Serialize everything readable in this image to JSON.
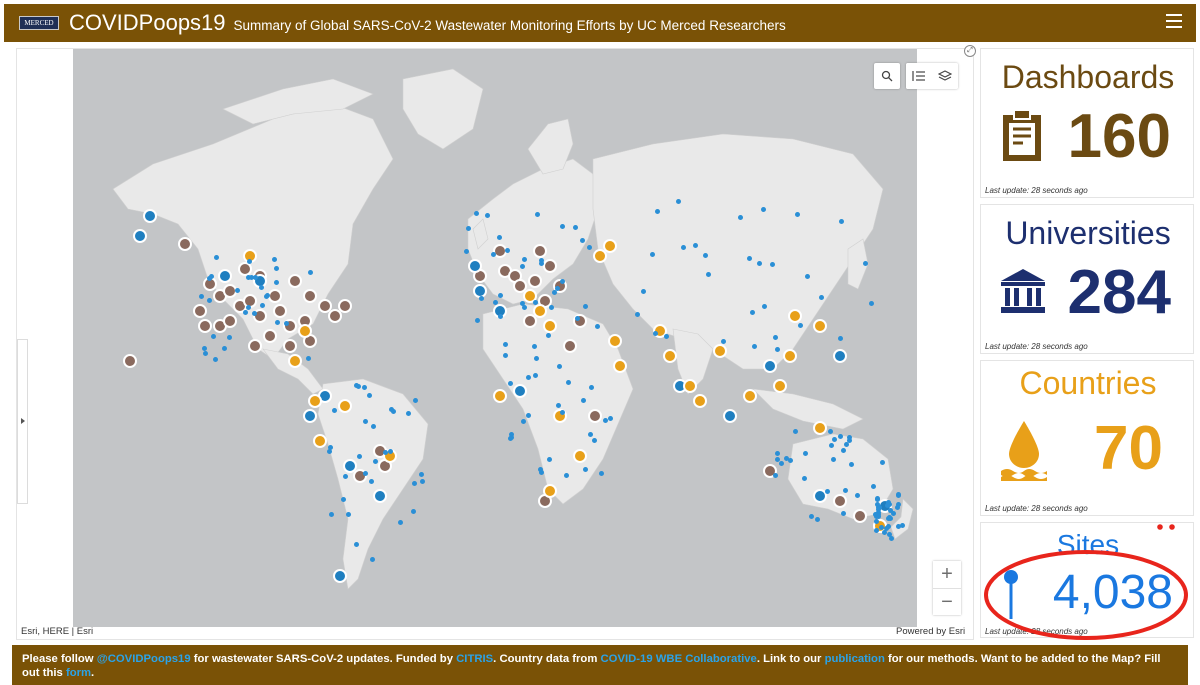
{
  "header": {
    "logo_text": "MERCED",
    "title": "COVIDPoops19",
    "subtitle": "Summary of Global SARS-CoV-2 Wastewater Monitoring Efforts by UC Merced Researchers"
  },
  "map": {
    "attribution": "Esri, HERE | Esri",
    "powered_by": "Powered by Esri",
    "zoom_in": "+",
    "zoom_out": "−"
  },
  "cards": {
    "dashboards": {
      "title": "Dashboards",
      "value": "160",
      "update": "Last update: 28 seconds ago",
      "color": "#6b4a12",
      "icon": "clipboard-icon"
    },
    "universities": {
      "title": "Universities",
      "value": "284",
      "update": "Last update: 28 seconds ago",
      "color": "#1d2f6f",
      "icon": "university-icon"
    },
    "countries": {
      "title": "Countries",
      "value": "70",
      "update": "Last update: 28 seconds ago",
      "color": "#e8a019",
      "icon": "water-drop-icon"
    },
    "sites": {
      "title": "Sites",
      "value": "4,038",
      "update": "Last update: 28 seconds ago",
      "color": "#1a78e0",
      "icon": "map-pin-icon"
    }
  },
  "footer": {
    "t1": "Please follow ",
    "l1": "@COVIDPoops19",
    "t2": " for wastewater SARS-CoV-2 updates. Funded by ",
    "l2": "CITRIS",
    "t3": ". Country data from ",
    "l3": "COVID-19 WBE Collaborative",
    "t4": ". Link to our ",
    "l4": "publication",
    "t5": " for our methods. Want to be added to the Map? Fill out this ",
    "l5": "form",
    "t6": "."
  },
  "colors": {
    "header_bg": "#7a5206",
    "dashboard_marker": "#8a6a5e",
    "university_marker": "#1f7fc0",
    "country_marker": "#e8a019",
    "site_marker": "#2a8fd6",
    "land": "#e8e8e8",
    "ocean": "#c3c5c7"
  }
}
